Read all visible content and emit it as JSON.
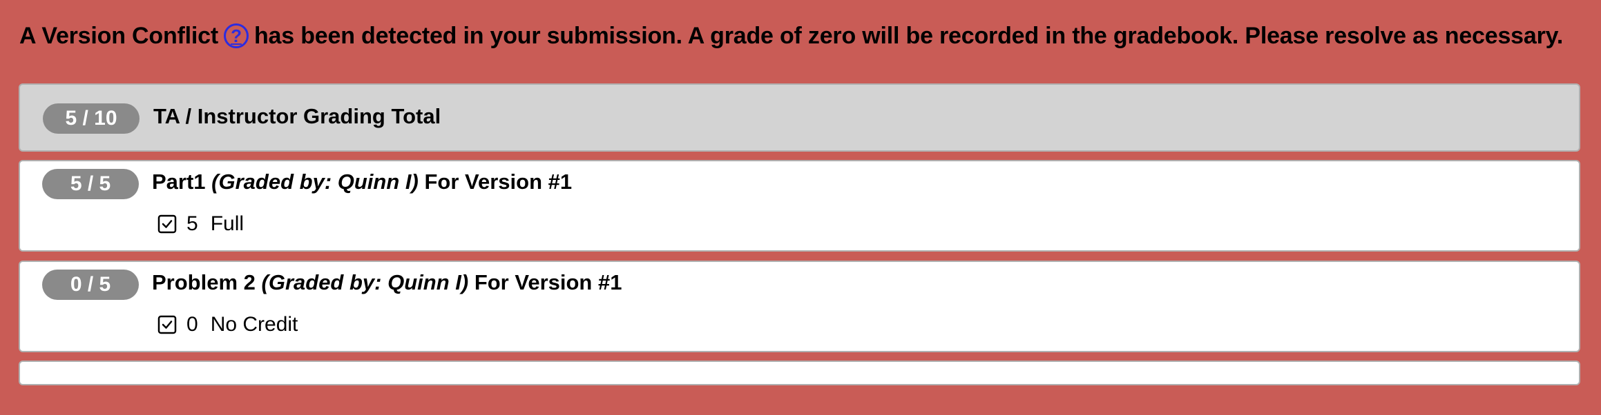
{
  "banner": {
    "before_icon": "A Version Conflict",
    "icon": "help-circle-icon",
    "icon_glyph": "?",
    "after_icon": "has been detected in your submission. A grade of zero will be recorded in the gradebook. Please resolve as necessary."
  },
  "total": {
    "score": "5 / 10",
    "label": "TA / Instructor Grading Total"
  },
  "components": [
    {
      "score": "5 / 5",
      "name": "Part1",
      "grader": "(Graded by: Quinn I)",
      "version": "For Version #1",
      "mark": {
        "points": "5",
        "label": "Full"
      }
    },
    {
      "score": "0 / 5",
      "name": "Problem 2",
      "grader": "(Graded by: Quinn I)",
      "version": "For Version #1",
      "mark": {
        "points": "0",
        "label": "No Credit"
      }
    }
  ],
  "colors": {
    "page_background": "#c95c56",
    "total_panel": "#d3d3d3",
    "score_pill": "#8a8a8a",
    "help_icon": "#2c2ce0"
  }
}
